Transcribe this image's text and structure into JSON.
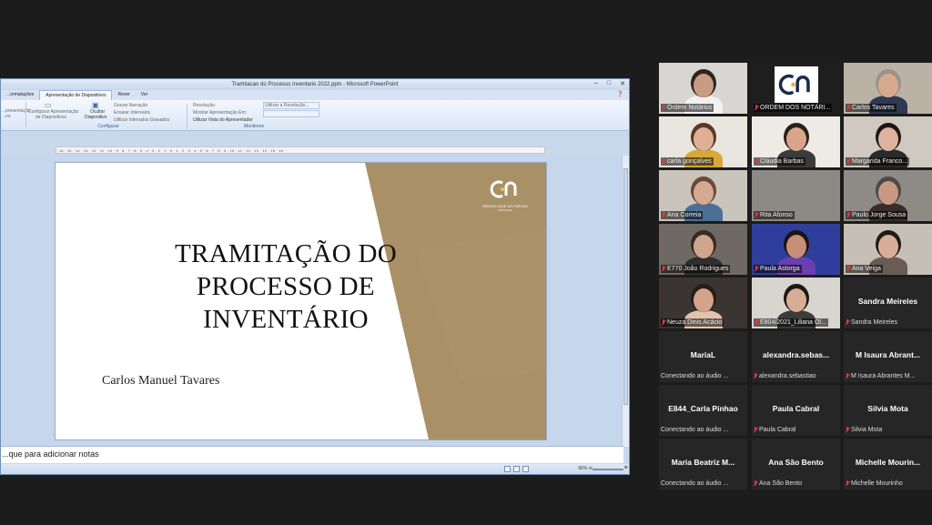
{
  "powerpoint": {
    "window_title": "Tramitacao do Processo Inventario 2022.pptx - Microsoft PowerPoint",
    "tabs": [
      "...ormatações",
      "Apresentação de Diapositivos",
      "Rever",
      "Ver"
    ],
    "active_tab": 1,
    "ribbon": {
      "start_button": "...presentação",
      "start_button_sub": "...os",
      "setup_button": "Configurar Apresentação",
      "setup_button_sub": "de Diapositivos",
      "hide_button": "Ocultar",
      "hide_button_sub": "Diapositivo",
      "record_narration": "Gravar Narração",
      "rehearse_timings": "Ensaiar Intervalos",
      "use_timings": "Utilizar Intervalos Gravados",
      "setup_group_label": "Configurar",
      "resolution": "Resolução:",
      "show_on": "Mostrar Apresentação Em:",
      "presenter_view": "Utilizar Vista do Apresentador",
      "monitors_group_label": "Monitores",
      "resolution_value": "Utilizar a Resolução...",
      "show_on_value": ""
    },
    "ruler_text": "· 16 · 15 · 14 · 13 · 12 · 11 · 10 · 9 · 8 · 7 · 6 · 5 · 4 · 3 · 2 · 1 · 0 · 1 · 2 · 3 · 4 · 5 · 6 · 7 · 8 · 9 · 10 · 11 · 12 · 13 · 14 · 15 · 16 ·",
    "notes_placeholder": "...que para adicionar notas",
    "zoom_level": "66%",
    "zoom_minus": "⊖",
    "zoom_plus": "⊕"
  },
  "slide": {
    "title_line1": "TRAMITAÇÃO DO",
    "title_line2": "PROCESSO DE",
    "title_line3": "INVENTÁRIO",
    "author": "Carlos Manuel Tavares",
    "logo_text": "ORDEM DOS NOTÁRIOS",
    "logo_subtext": "PORTUGAL",
    "accent_color": "#a99066",
    "accent_color_light": "#b8a07a"
  },
  "participants": [
    {
      "name": "Ordem Notários",
      "kind": "video",
      "bg": "#d8d6d2",
      "skin": "#c89c84",
      "shirt": "#f1f1f1",
      "hair": "#2e2520"
    },
    {
      "name": "ORDEM DOS NOTÁRI...",
      "kind": "logo"
    },
    {
      "name": "Carlos Tavares",
      "kind": "video",
      "bg": "#b9b2a5",
      "skin": "#d9a98f",
      "shirt": "#2d3a52",
      "hair": "#9a948a",
      "active": true
    },
    {
      "name": "carla gonçalves",
      "kind": "video",
      "bg": "#e9e6df",
      "skin": "#e0b096",
      "shirt": "#d7a93a",
      "hair": "#5a3a26"
    },
    {
      "name": "Cláudia Barbas",
      "kind": "video",
      "bg": "#eeeae6",
      "skin": "#d9a48c",
      "shirt": "#3b3b3b",
      "hair": "#2a1f1a"
    },
    {
      "name": "Margarida Franco...",
      "kind": "video",
      "bg": "#cfc9c2",
      "skin": "#dcb39e",
      "shirt": "#2a2a2a",
      "hair": "#1f1612"
    },
    {
      "name": "Ana Correia",
      "kind": "video",
      "bg": "#c9c4bc",
      "skin": "#d6aa92",
      "shirt": "#4b6f95",
      "hair": "#6a4a34"
    },
    {
      "name": "Rita Afonso",
      "kind": "blank",
      "bg": "#8d8a86"
    },
    {
      "name": "Paulo Jorge Sousa",
      "kind": "video",
      "bg": "#8e8a86",
      "skin": "#c89882",
      "shirt": "#3a2d27",
      "hair": "#4a4a4a"
    },
    {
      "name": "E770 João Rodrigues",
      "kind": "video",
      "bg": "#6e6963",
      "skin": "#cfa58e",
      "shirt": "#2e2e2e",
      "hair": "#3b2a20"
    },
    {
      "name": "Paula Astorga",
      "kind": "video",
      "bg": "#2f3e9c",
      "skin": "#c78e78",
      "shirt": "#6a3fb0",
      "hair": "#1c1412"
    },
    {
      "name": "Ana Veiga",
      "kind": "video",
      "bg": "#c6bfb6",
      "skin": "#d9ae98",
      "shirt": "#6a5c54",
      "hair": "#241a15"
    },
    {
      "name": "Neuza Dinis Acácio",
      "kind": "video",
      "bg": "#3a3532",
      "skin": "#d3a48c",
      "shirt": "#e3c3b0",
      "hair": "#2b1c16"
    },
    {
      "name": "E804/2021_Liliana Ol...",
      "kind": "video",
      "bg": "#d8d4cf",
      "skin": "#d9ad95",
      "shirt": "#3d3a3a",
      "hair": "#1e1814"
    },
    {
      "name": "Sandra Meireles",
      "kind": "name",
      "label": "Sandra Meireles"
    },
    {
      "name": "Conectando ao áudio ...",
      "kind": "name",
      "label": "MariaL"
    },
    {
      "name": "alexandra.sebastiao",
      "kind": "name",
      "label": "alexandra.sebas..."
    },
    {
      "name": "M Isaura Abrantes M...",
      "kind": "name",
      "label": "M Isaura Abrant..."
    },
    {
      "name": "Conectando ao áudio ...",
      "kind": "name",
      "label": "E844_Carla Pinhao"
    },
    {
      "name": "Paula Cabral",
      "kind": "name",
      "label": "Paula Cabral"
    },
    {
      "name": "Silvia Mota",
      "kind": "name",
      "label": "Silvia Mota"
    },
    {
      "name": "Conectando ao áudio ...",
      "kind": "name",
      "label": "Maria Beatriz M..."
    },
    {
      "name": "Ana São Bento",
      "kind": "name",
      "label": "Ana São Bento"
    },
    {
      "name": "Michelle Mourinho",
      "kind": "name",
      "label": "Michelle Mourin..."
    }
  ]
}
